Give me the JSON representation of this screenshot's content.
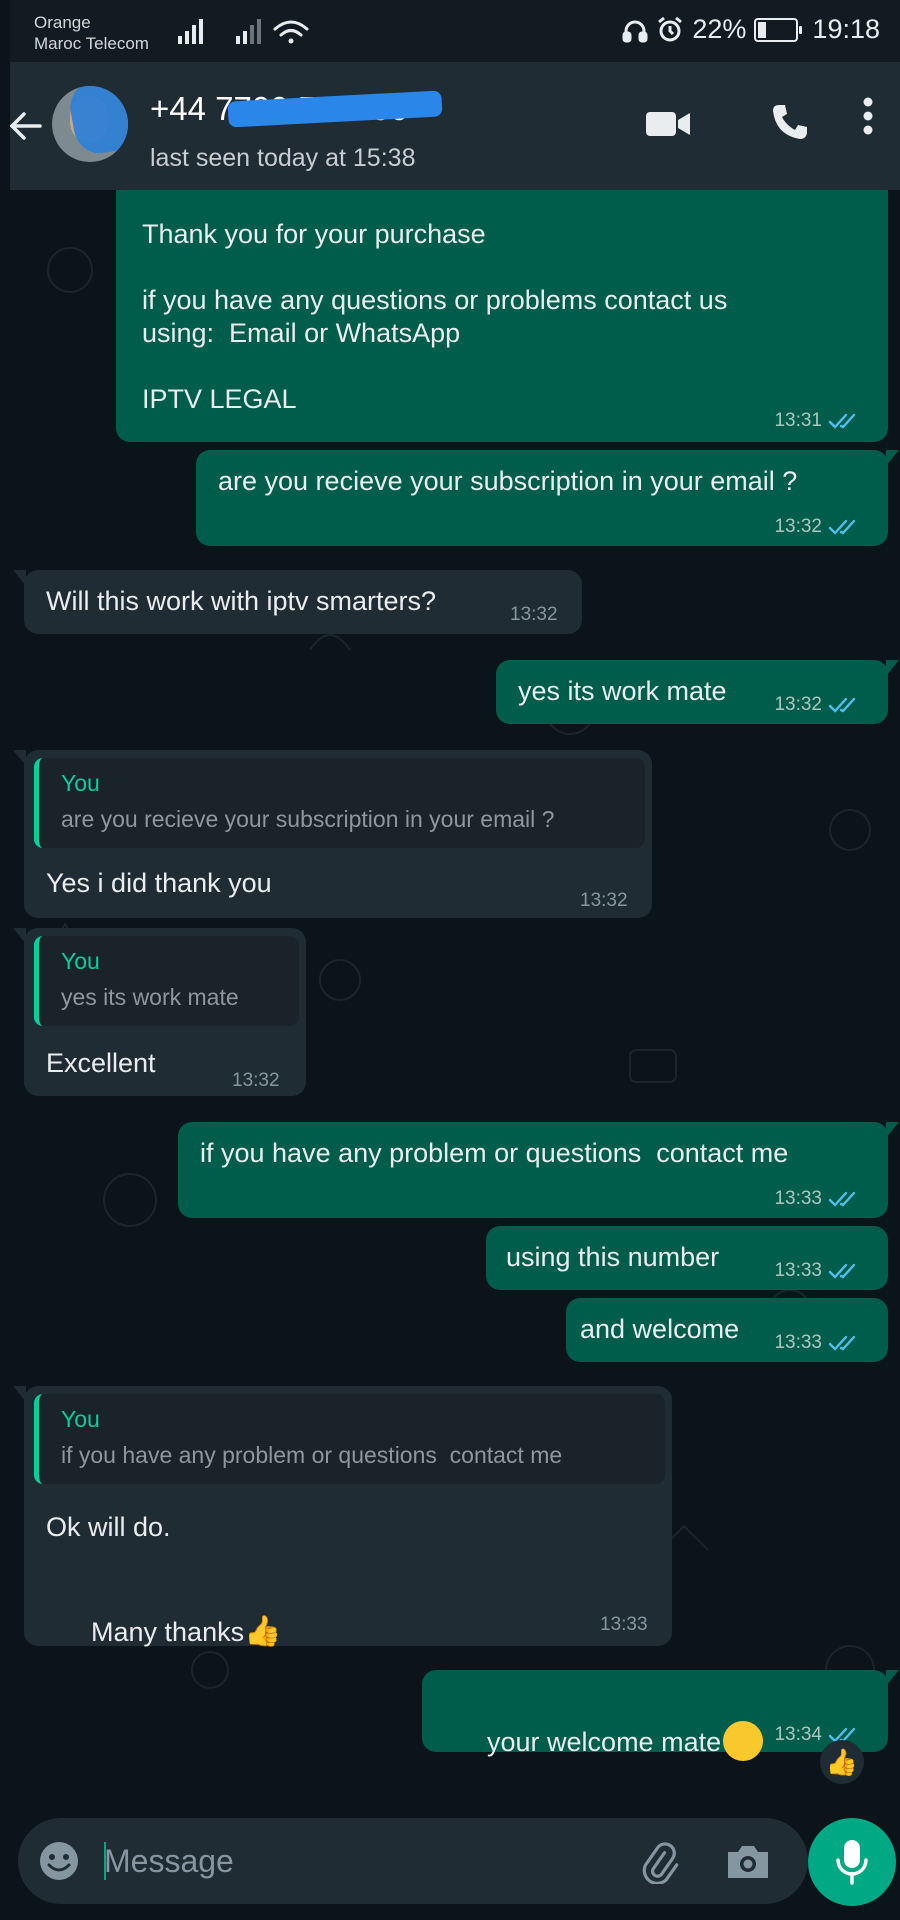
{
  "status_bar": {
    "carrier_line1": "Orange",
    "carrier_line2": "Maroc Telecom",
    "battery": "22%",
    "battery_level": 0.22,
    "time": "19:18"
  },
  "header": {
    "contact": "+44 7700 503536",
    "last_seen": "last seen today at 15:38"
  },
  "messages": [
    {
      "direction": "out",
      "text": "Thank you for your purchase\n\nif you have any questions or problems contact us\nusing:  Email or WhatsApp\n\nIPTV LEGAL",
      "time": "13:31",
      "read": true
    },
    {
      "direction": "out",
      "text": "are you recieve your subscription in your email ?",
      "time": "13:32",
      "read": true
    },
    {
      "direction": "in",
      "text": "Will this work with iptv smarters?",
      "time": "13:32"
    },
    {
      "direction": "out",
      "text": "yes its work mate",
      "time": "13:32",
      "read": true
    },
    {
      "direction": "in",
      "quote_author": "You",
      "quote_text": "are you recieve your subscription in your email ?",
      "text": "Yes i did thank you",
      "time": "13:32"
    },
    {
      "direction": "in",
      "quote_author": "You",
      "quote_text": "yes its work mate",
      "text": "Excellent",
      "time": "13:32"
    },
    {
      "direction": "out",
      "text": "if you have any problem or questions  contact me",
      "time": "13:33",
      "read": true
    },
    {
      "direction": "out",
      "text": "using this number",
      "time": "13:33",
      "read": true
    },
    {
      "direction": "out",
      "text": "and welcome",
      "time": "13:33",
      "read": true
    },
    {
      "direction": "in",
      "quote_author": "You",
      "quote_text": "if you have any problem or questions  contact me",
      "text_line1": "Ok will do.",
      "text_line2": "Many thanks",
      "emoji": "👍",
      "time": "13:33"
    },
    {
      "direction": "out",
      "text": "your welcome mate",
      "emoji": "smiling-face",
      "time": "13:34",
      "read": true,
      "reaction": "👍"
    }
  ],
  "composer": {
    "placeholder": "Message"
  },
  "colors": {
    "header_bg": "#1f2c34",
    "chat_bg": "#0b141a",
    "outgoing_bubble": "#005c4b",
    "incoming_bubble": "#202c33",
    "accent": "#00a884",
    "read_ticks": "#53bdeb",
    "quote_author": "#06cf9c"
  },
  "icons": [
    "back-arrow-icon",
    "video-call-icon",
    "voice-call-icon",
    "more-options-icon",
    "emoji-icon",
    "attach-icon",
    "camera-icon",
    "mic-icon"
  ]
}
